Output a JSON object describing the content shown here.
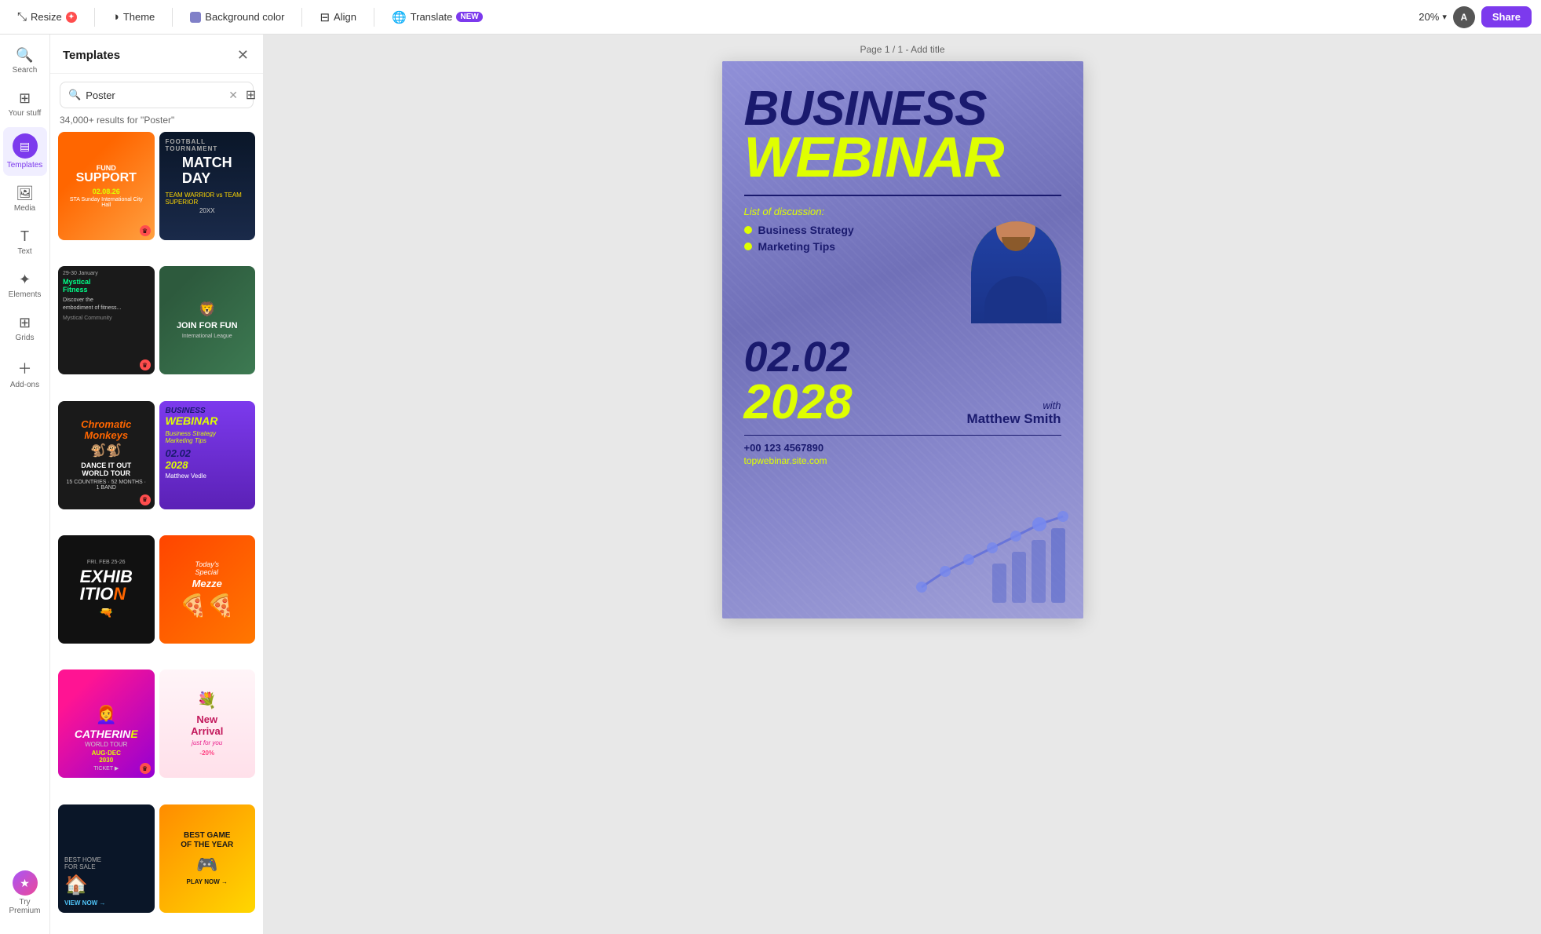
{
  "toolbar": {
    "resize_label": "Resize",
    "theme_label": "Theme",
    "bg_color_label": "Background color",
    "align_label": "Align",
    "translate_label": "Translate",
    "translate_badge": "NEW",
    "zoom_level": "20%",
    "page_label": "Page 1 / 1 - Add title"
  },
  "sidebar": {
    "search_label": "Search",
    "your_stuff_label": "Your stuff",
    "templates_label": "Templates",
    "media_label": "Media",
    "text_label": "Text",
    "elements_label": "Elements",
    "grids_label": "Grids",
    "add_ons_label": "Add-ons",
    "try_premium_label": "Try Premium"
  },
  "templates_panel": {
    "title": "Templates",
    "search_value": "Poster",
    "results_count": "34,000+ results for \"Poster\"",
    "filter_icon": "⊞"
  },
  "poster": {
    "business": "BUSINESS",
    "webinar": "WEBINAR",
    "discussion_label": "List of discussion:",
    "bullet1": "Business Strategy",
    "bullet2": "Marketing Tips",
    "date_day": "02.02",
    "date_year": "2028",
    "with_text": "with",
    "speaker_name": "Matthew Smith",
    "phone": "+00 123 4567890",
    "website": "topwebinar.site.com"
  }
}
